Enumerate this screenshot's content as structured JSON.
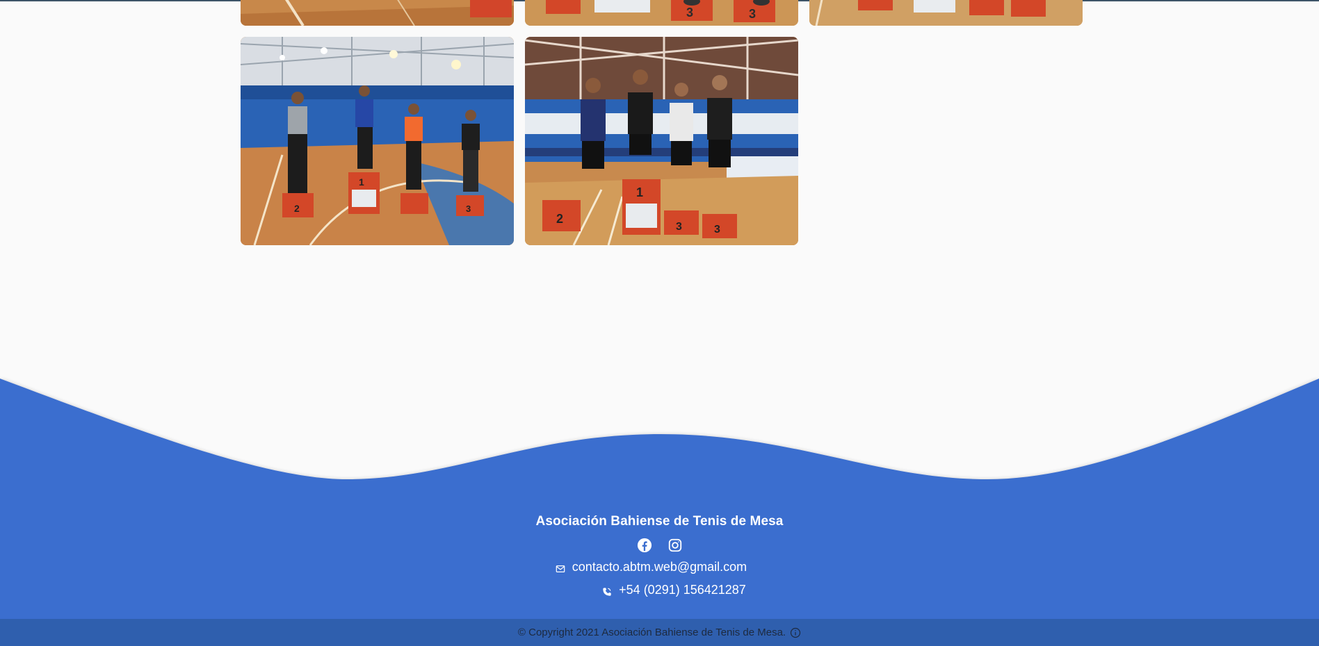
{
  "gallery": {
    "photos": [
      {
        "alt": "Podio torneo 1",
        "row": 1
      },
      {
        "alt": "Podio torneo 2",
        "row": 1
      },
      {
        "alt": "Podio torneo 3",
        "row": 1
      },
      {
        "alt": "Podio torneo 4",
        "row": 2
      },
      {
        "alt": "Podio torneo 5",
        "row": 2
      }
    ]
  },
  "footer": {
    "org_name": "Asociación Bahiense de Tenis de Mesa",
    "socials": [
      {
        "name": "facebook-icon"
      },
      {
        "name": "instagram-icon"
      }
    ],
    "email": "contacto.abtm.web@gmail.com",
    "phone": "+54 (0291) 156421287",
    "copyright": "© Copyright 2021 Asociación Bahiense de Tenis de Mesa.",
    "colors": {
      "wave": "#3b6ecf",
      "bar": "#2f5fae",
      "background": "#fafafa"
    }
  }
}
